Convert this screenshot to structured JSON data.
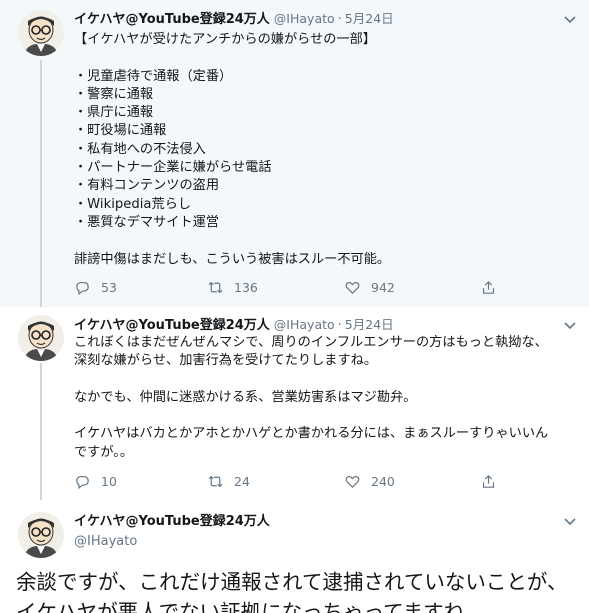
{
  "tweets": [
    {
      "display_name": "イケハヤ@YouTube登録24万人",
      "handle": "@IHayato",
      "date": "5月24日",
      "body": "【イケハヤが受けたアンチからの嫌がらせの一部】\n\n・児童虐待で通報（定番）\n・警察に通報\n・県庁に通報\n・町役場に通報\n・私有地への不法侵入\n・パートナー企業に嫌がらせ電話\n・有料コンテンツの盗用\n・Wikipedia荒らし\n・悪質なデマサイト運営\n\n誹謗中傷はまだしも、こういう被害はスルー不可能。",
      "replies": "53",
      "retweets": "136",
      "likes": "942"
    },
    {
      "display_name": "イケハヤ@YouTube登録24万人",
      "handle": "@IHayato",
      "date": "5月24日",
      "body": "これぼくはまだぜんぜんマシで、周りのインフルエンサーの方はもっと執拗な、\n深刻な嫌がらせ、加害行為を受けてたりしますね。\n\nなかでも、仲間に迷惑かける系、営業妨害系はマジ勘弁。\n\nイケハヤはバカとかアホとかハゲとか書かれる分には、まぁスルーすりゃいいん\nですが。。",
      "replies": "10",
      "retweets": "24",
      "likes": "240"
    },
    {
      "display_name": "イケハヤ@YouTube登録24万人",
      "handle": "@IHayato",
      "body": "余談ですが、これだけ通報されて逮捕されていないことが、\nイケハヤが悪人でない証拠になっちゃってますね。"
    }
  ],
  "icons": {
    "reply": "reply-icon",
    "retweet": "retweet-icon",
    "like": "heart-icon",
    "share": "share-icon",
    "more": "chevron-down-icon"
  },
  "colors": {
    "text": "#14171a",
    "muted": "#657786",
    "thread": "#ccd6dd",
    "highlight_bg": "#f5f8fa"
  }
}
